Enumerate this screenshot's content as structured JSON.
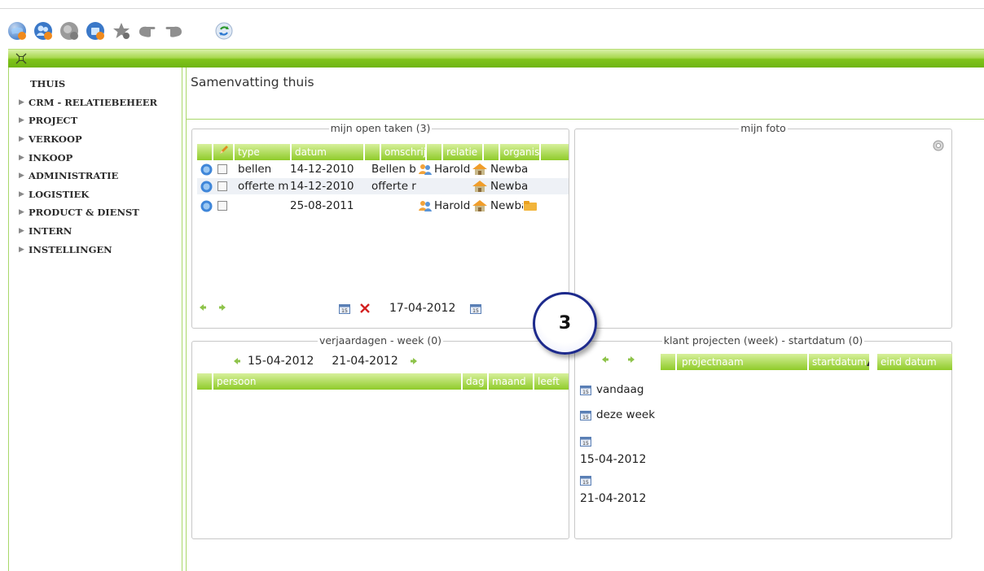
{
  "toolbar": {
    "icons": [
      "home-globe-icon",
      "people-icon",
      "bubble-icon",
      "briefcase-icon",
      "star-icon",
      "hand-left-icon",
      "hand-right-icon",
      "refresh-icon"
    ]
  },
  "sidebar": {
    "items": [
      {
        "label": "THUIS",
        "expandable": false
      },
      {
        "label": "CRM - RELATIEBEHEER",
        "expandable": true
      },
      {
        "label": "PROJECT",
        "expandable": true
      },
      {
        "label": "VERKOOP",
        "expandable": true
      },
      {
        "label": "INKOOP",
        "expandable": true
      },
      {
        "label": "ADMINISTRATIE",
        "expandable": true
      },
      {
        "label": "LOGISTIEK",
        "expandable": true
      },
      {
        "label": "PRODUCT & DIENST",
        "expandable": true
      },
      {
        "label": "INTERN",
        "expandable": true
      },
      {
        "label": "INSTELLINGEN",
        "expandable": true
      }
    ]
  },
  "main": {
    "title": "Samenvatting thuis"
  },
  "tasks": {
    "title": "mijn open taken (3)",
    "columns": [
      "type",
      "datum",
      "omschrij",
      "relatie",
      "organis"
    ],
    "rows": [
      {
        "type": "bellen",
        "datum": "14-12-2010",
        "omschrijving": "Bellen b",
        "relatie": "Harold",
        "organisatie": "Newba"
      },
      {
        "type": "offerte m",
        "datum": "14-12-2010",
        "omschrijving": "offerte r",
        "relatie": "",
        "organisatie": "Newba"
      },
      {
        "type": "",
        "datum": "25-08-2011",
        "omschrijving": "",
        "relatie": "Harold",
        "organisatie": "Newba"
      }
    ],
    "footer_date": "17-04-2012"
  },
  "photo": {
    "title": "mijn foto"
  },
  "birthdays": {
    "title": "verjaardagen - week (0)",
    "from": "15-04-2012",
    "to": "21-04-2012",
    "columns": [
      "persoon",
      "dag",
      "maand",
      "leeft"
    ]
  },
  "projects": {
    "title": "klant projecten (week) - startdatum (0)",
    "columns": [
      "projectnaam",
      "startdatum",
      "eind datum"
    ],
    "sort_marker": "▲",
    "today_label": "vandaag",
    "week_label": "deze week",
    "date_from": "15-04-2012",
    "date_to": "21-04-2012"
  },
  "callout": {
    "number": "3"
  },
  "colors": {
    "accent_green": "#8fcb2a",
    "callout_border": "#1d2a8c"
  }
}
